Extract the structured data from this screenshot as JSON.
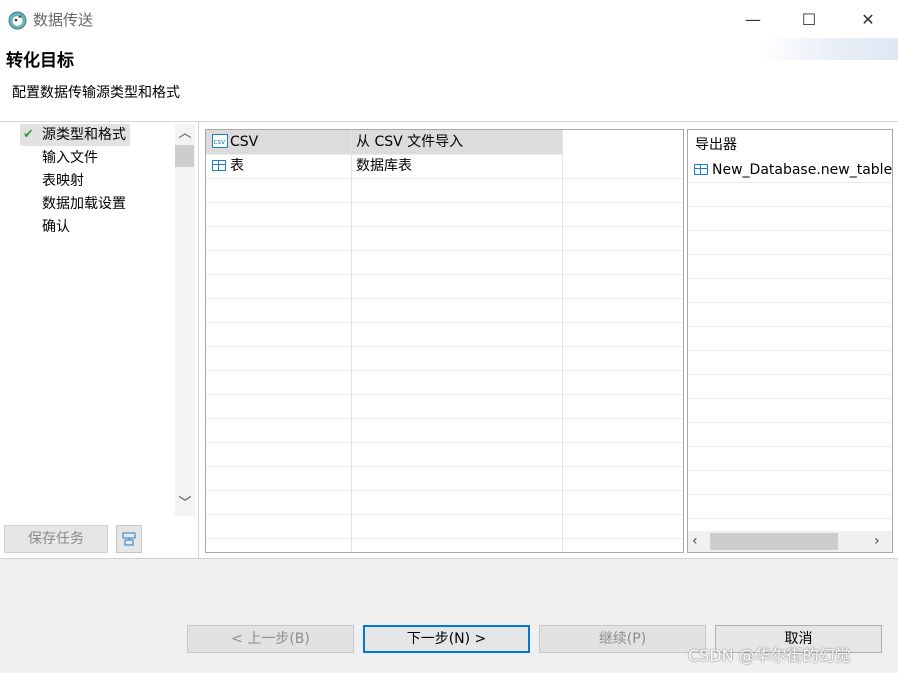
{
  "window": {
    "title": "数据传送",
    "minimize_label": "—",
    "maximize_label": "☐",
    "close_label": "✕"
  },
  "header": {
    "heading": "转化目标",
    "subtitle": "配置数据传输源类型和格式"
  },
  "steps": [
    {
      "label": "源类型和格式",
      "done": true
    },
    {
      "label": "输入文件"
    },
    {
      "label": "表映射"
    },
    {
      "label": "数据加载设置"
    },
    {
      "label": "确认"
    }
  ],
  "nav": {
    "check": "✔",
    "scroll_up": "︿",
    "scroll_down": "﹀"
  },
  "left_buttons": {
    "save_task": "保存任务"
  },
  "source_types": {
    "rows": [
      {
        "name": "CSV",
        "description": "从 CSV 文件导入",
        "selected": true,
        "icon": "csv-icon"
      },
      {
        "name": "表",
        "description": "数据库表",
        "selected": false,
        "icon": "table-icon"
      }
    ]
  },
  "target": {
    "header": "导出器",
    "rows": [
      {
        "name": "New_Database.new_table",
        "icon": "table-icon"
      }
    ],
    "scroll_left": "‹",
    "scroll_right": "›"
  },
  "footer": {
    "back": "< 上一步(B)",
    "next": "下一步(N) >",
    "proceed": "继续(P)",
    "cancel": "取消"
  },
  "watermark": "CSDN @华尔街的幻觉",
  "colors": {
    "accent": "#0078d7",
    "selection": "#dcdcdc",
    "icon_blue": "#1f7fc6",
    "check_green": "#3e9a3e"
  }
}
